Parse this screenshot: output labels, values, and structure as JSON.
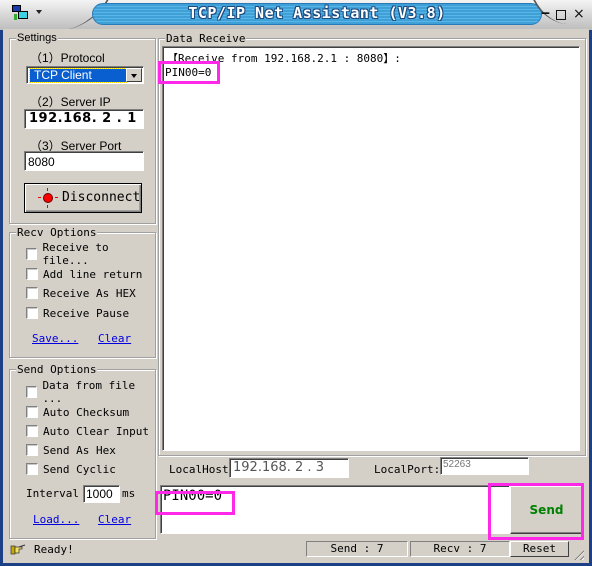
{
  "window": {
    "title": "TCP/IP Net Assistant (V3.8)",
    "icons": [
      "app-icon",
      "system-menu-arrow",
      "minimize-icon",
      "maximize-icon",
      "close-icon"
    ],
    "min_glyph": "‒",
    "close_glyph": "×"
  },
  "settings": {
    "group_label": "Settings",
    "protocol_label": "（1）Protocol",
    "protocol_value": "TCP Client",
    "server_ip_label": "（2）Server IP",
    "server_ip_value": "192.168. 2 . 1",
    "server_port_label": "（3）Server Port",
    "server_port_value": "8080",
    "connect_button_label": "Disconnect",
    "connection_led_color": "#ff0000"
  },
  "recv_options": {
    "group_label": "Recv Options",
    "checkboxes": [
      {
        "label": "Receive to file...",
        "checked": false
      },
      {
        "label": "Add line return",
        "checked": false
      },
      {
        "label": "Receive As HEX",
        "checked": false
      },
      {
        "label": "Receive Pause",
        "checked": false
      }
    ],
    "save_link": "Save...",
    "clear_link": "Clear"
  },
  "send_options": {
    "group_label": "Send Options",
    "checkboxes": [
      {
        "label": "Data from file ...",
        "checked": false
      },
      {
        "label": "Auto Checksum",
        "checked": false
      },
      {
        "label": "Auto Clear Input",
        "checked": false
      },
      {
        "label": "Send As Hex",
        "checked": false
      },
      {
        "label": "Send Cyclic",
        "checked": false
      }
    ],
    "interval_label": "Interval",
    "interval_value": "1000",
    "interval_unit": "ms",
    "load_link": "Load...",
    "clear_link": "Clear"
  },
  "data_receive": {
    "group_label": "Data Receive",
    "lines": [
      "【Receive from 192.168.2.1 : 8080】:",
      "PIN00=0"
    ]
  },
  "local": {
    "host_label": "LocalHost:",
    "host_value": "192.168. 2 . 3",
    "port_label": "LocalPort:",
    "port_value": "52263"
  },
  "send": {
    "input_value": "PIN00=0",
    "button_label": "Send",
    "button_color": "#008000"
  },
  "highlight_color": "#ff28e8",
  "status": {
    "ready_text": "Ready!",
    "send_count": "Send : 7",
    "recv_count": "Recv : 7",
    "reset_label": "Reset"
  }
}
